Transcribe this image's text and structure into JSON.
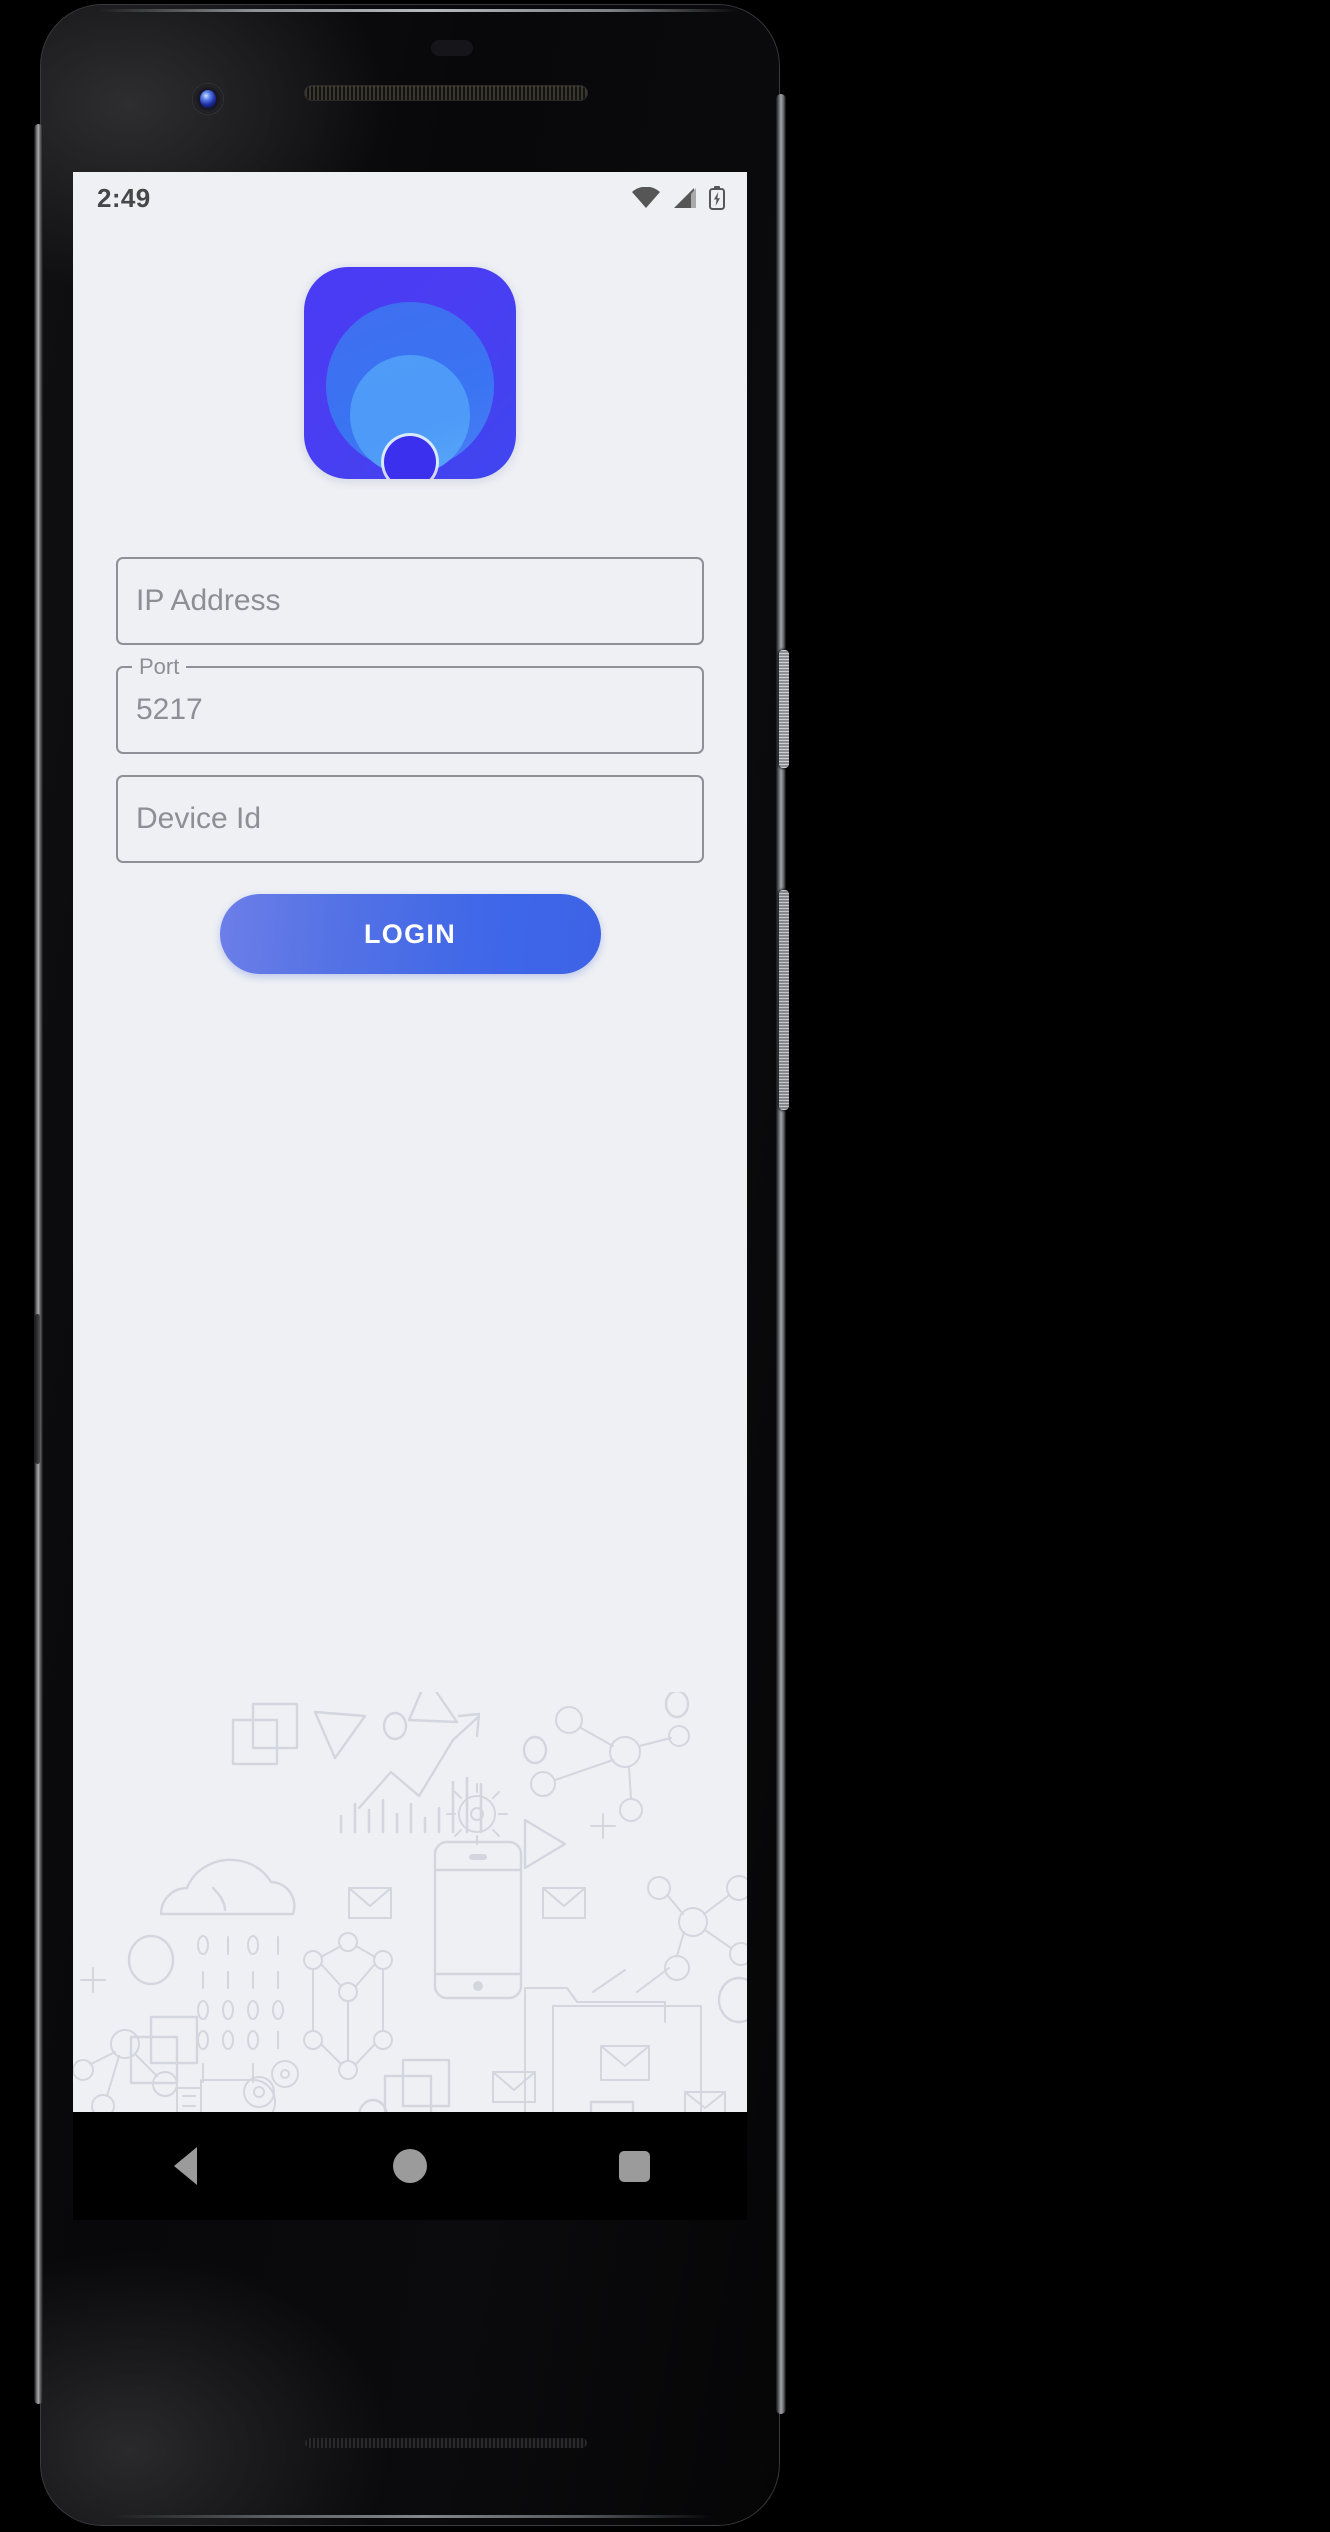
{
  "device": {
    "name": "android-phone-mockup",
    "hardware": {
      "power_button": "power-button",
      "volume_button": "volume-rocker",
      "front_camera": "front-camera",
      "earpiece": "earpiece-speaker",
      "bottom_speaker": "bottom-speaker-grille"
    }
  },
  "status_bar": {
    "time": "2:49",
    "icons": [
      "wifi-icon",
      "cell-signal-icon",
      "battery-charging-icon"
    ]
  },
  "app": {
    "logo": {
      "name": "app-logo-concentric-signal",
      "colors": {
        "tile": "#4a3bf5",
        "ring_outer": "#3f6ef0",
        "ring_mid": "#4e9bf8",
        "core": "#3a30ee"
      }
    },
    "background_color": "#eef0f4",
    "illustration": {
      "name": "tech-line-art-illustration",
      "stroke_color": "#c3c7d2",
      "motifs": [
        "cloud-icon",
        "binary-rain",
        "bar-chart-icon",
        "trend-arrow-icon",
        "network-nodes-icon",
        "wireframe-cube-icon",
        "smartphone-icon",
        "envelope-icon",
        "folder-icon",
        "gear-icon",
        "usb-drive-icon",
        "overlapping-squares",
        "triangle-outline",
        "circle-outline",
        "plus-mark"
      ]
    }
  },
  "form": {
    "fields": [
      {
        "name": "ip-address-field",
        "label": "",
        "placeholder": "IP Address",
        "value": "",
        "has_floating_label": false
      },
      {
        "name": "port-field",
        "label": "Port",
        "placeholder": "5217",
        "value": "",
        "has_floating_label": true
      },
      {
        "name": "device-id-field",
        "label": "",
        "placeholder": "Device Id",
        "value": "",
        "has_floating_label": false
      }
    ],
    "submit_label": "LOGIN",
    "submit_gradient": [
      "#6c7ee8",
      "#3d62e6"
    ],
    "field_border_color": "#8e9095",
    "placeholder_color": "#8d8f94"
  },
  "nav_bar": {
    "background": "#000000",
    "glyph_color": "#9b9b9b",
    "buttons": [
      {
        "name": "nav-back-button",
        "icon": "triangle-back-icon"
      },
      {
        "name": "nav-home-button",
        "icon": "circle-home-icon"
      },
      {
        "name": "nav-recents-button",
        "icon": "square-recents-icon"
      }
    ]
  }
}
